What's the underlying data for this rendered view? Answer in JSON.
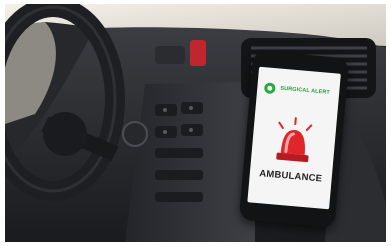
{
  "phone": {
    "alert_label": "SURGICAL ALERT",
    "main_label": "AMBULANCE"
  },
  "icons": {
    "alert": "green-circle-icon",
    "siren": "siren-light-icon"
  },
  "colors": {
    "alert_green": "#27a845",
    "siren_red": "#e0262b",
    "dashboard": "#1c1d20"
  }
}
